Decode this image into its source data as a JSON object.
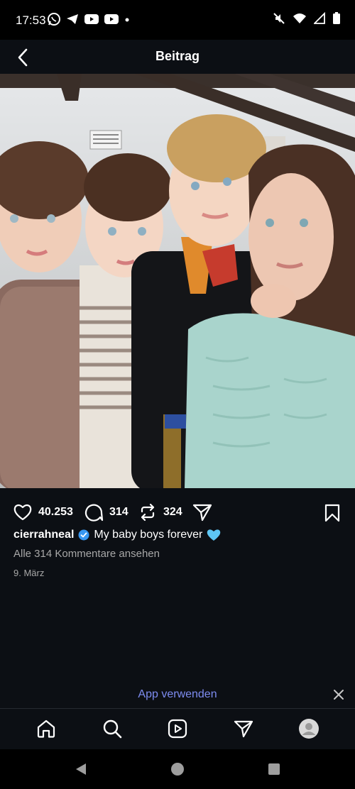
{
  "status_bar": {
    "time": "17:53",
    "notification_icons": [
      "whatsapp-icon",
      "telegram-icon",
      "youtube-icon",
      "youtube-icon",
      "dot-icon"
    ],
    "system_icons": [
      "mute-icon",
      "wifi-icon",
      "signal-icon",
      "battery-icon"
    ]
  },
  "header": {
    "title": "Beitrag"
  },
  "post": {
    "likes": "40.253",
    "comments": "314",
    "reposts": "324",
    "username": "cierrahneal",
    "verified": true,
    "caption": "My baby boys forever",
    "caption_emoji": "light-blue-heart-icon",
    "view_comments": "Alle 314 Kommentare ansehen",
    "date": "9. März"
  },
  "banner": {
    "label": "App verwenden"
  },
  "bottom_nav": [
    "home-icon",
    "search-icon",
    "reels-icon",
    "send-icon",
    "profile-avatar"
  ],
  "colors": {
    "background": "#0c0f14",
    "link_blue": "#7d8cf0",
    "verified_blue": "#3897f0",
    "heart_blue": "#5ec7f5"
  }
}
